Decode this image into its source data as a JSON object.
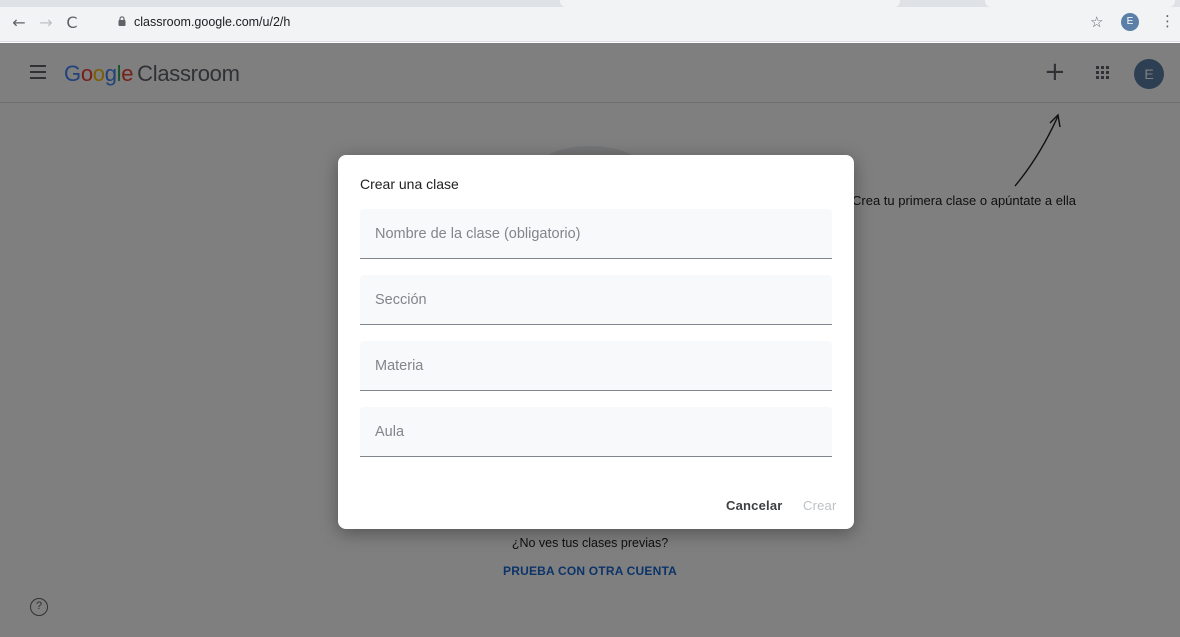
{
  "browser": {
    "url": "classroom.google.com/u/2/h",
    "avatar_letter": "E",
    "back_glyph": "←",
    "forward_glyph": "→",
    "reload_glyph": "C",
    "star_glyph": "☆",
    "kebab_glyph": "⋮"
  },
  "header": {
    "logo_letters": [
      "G",
      "o",
      "o",
      "g",
      "l",
      "e"
    ],
    "product": "Classroom",
    "plus_glyph": "+",
    "avatar_letter": "E"
  },
  "background": {
    "hint": "Crea tu primera clase o apúntate a ella",
    "no_classes": "¿No ves tus clases previas?",
    "switch_account": "PRUEBA CON OTRA CUENTA",
    "help_glyph": "?"
  },
  "dialog": {
    "title": "Crear una clase",
    "fields": [
      {
        "placeholder": "Nombre de la clase (obligatorio)",
        "value": ""
      },
      {
        "placeholder": "Sección",
        "value": ""
      },
      {
        "placeholder": "Materia",
        "value": ""
      },
      {
        "placeholder": "Aula",
        "value": ""
      }
    ],
    "cancel_label": "Cancelar",
    "create_label": "Crear"
  },
  "colors": {
    "accent": "#1967d2",
    "scrim": "rgba(0,0,0,0.5)",
    "disabled": "#bdc1c6"
  }
}
